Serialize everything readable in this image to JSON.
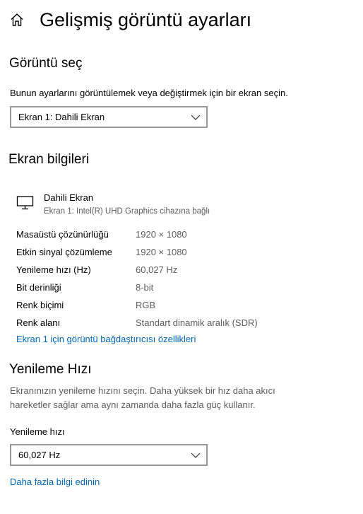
{
  "header": {
    "title": "Gelişmiş görüntü ayarları",
    "home_icon": "home-icon"
  },
  "select_display": {
    "heading": "Görüntü seç",
    "description": "Bunun ayarlarını görüntülemek veya değiştirmek için bir ekran seçin.",
    "selected": "Ekran 1: Dahili Ekran"
  },
  "display_info": {
    "heading": "Ekran bilgileri",
    "icon": "monitor-icon",
    "name": "Dahili Ekran",
    "subtitle": "Ekran 1: Intel(R) UHD Graphics cihazına bağlı",
    "rows": [
      {
        "label": "Masaüstü çözünürlüğü",
        "value": "1920 × 1080"
      },
      {
        "label": "Etkin sinyal çözümleme",
        "value": "1920 × 1080"
      },
      {
        "label": "Yenileme hızı (Hz)",
        "value": "60,027 Hz"
      },
      {
        "label": "Bit derinliği",
        "value": "8-bit"
      },
      {
        "label": "Renk biçimi",
        "value": "RGB"
      },
      {
        "label": "Renk alanı",
        "value": "Standart dinamik aralık (SDR)"
      }
    ],
    "adapter_link": "Ekran 1 için görüntü bağdaştırıcısı özellikleri"
  },
  "refresh_rate": {
    "heading": "Yenileme Hızı",
    "description_line1": "Ekranınızın yenileme hızını seçin. Daha yüksek bir hız daha akıcı",
    "description_line2": "hareketler sağlar ama aynı zamanda daha fazla güç kullanır.",
    "field_label": "Yenileme hızı",
    "selected": "60,027 Hz",
    "more_info_link": "Daha fazla bilgi edinin"
  },
  "colors": {
    "link": "#0067c0",
    "muted_text": "#5d5d5d",
    "dropdown_border": "#999999"
  }
}
